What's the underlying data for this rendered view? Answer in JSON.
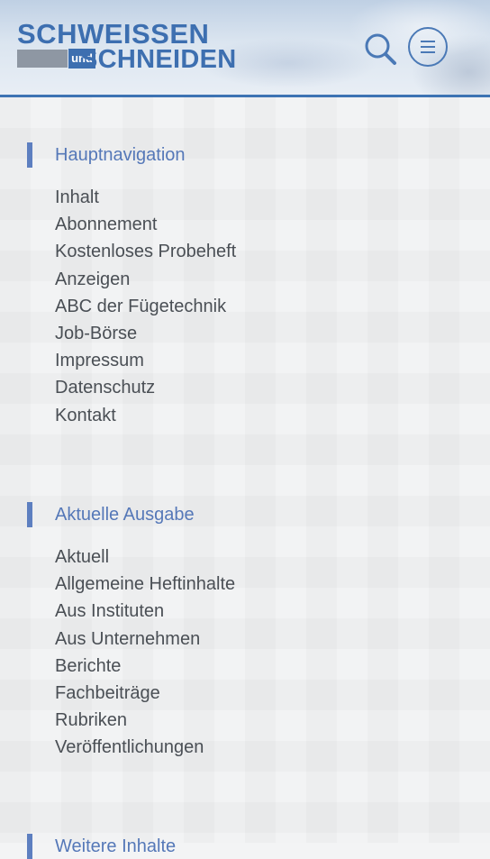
{
  "header": {
    "logo_top": "SCHWEISSEN",
    "logo_und": "und",
    "logo_bottom": "SCHNEIDEN",
    "search_icon": "search-icon",
    "menu_icon": "menu-icon"
  },
  "sections": [
    {
      "title": "Hauptnavigation",
      "items": [
        "Inhalt",
        "Abonnement",
        "Kostenloses Probeheft",
        "Anzeigen",
        "ABC der Fügetechnik",
        "Job-Börse",
        "Impressum",
        "Datenschutz",
        "Kontakt"
      ]
    },
    {
      "title": "Aktuelle Ausgabe",
      "items": [
        "Aktuell",
        "Allgemeine Heftinhalte",
        "Aus Instituten",
        "Aus Unternehmen",
        "Berichte",
        "Fachbeiträge",
        "Rubriken",
        "Veröffentlichungen"
      ]
    },
    {
      "title": "Weitere Inhalte",
      "items": []
    }
  ],
  "colors": {
    "accent": "#5578b8",
    "header_border": "#3d73b3",
    "text": "#4a4f55"
  }
}
